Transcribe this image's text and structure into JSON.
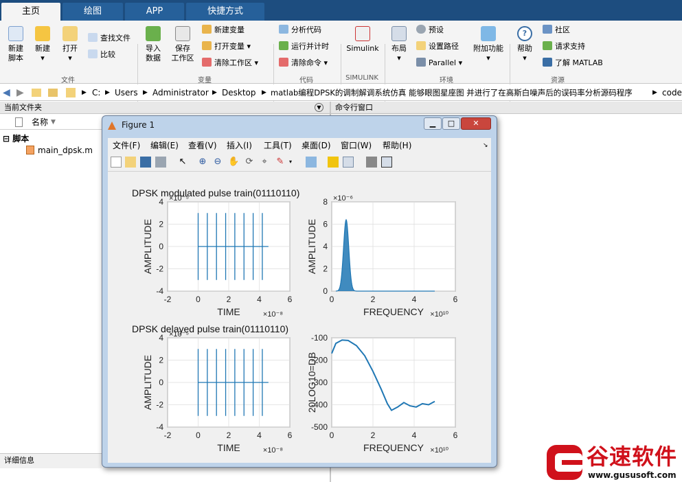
{
  "tabs": [
    "主页",
    "绘图",
    "APP",
    "快捷方式"
  ],
  "ribbon": {
    "file_group": {
      "label": "文件",
      "new_script": "新建\n脚本",
      "new": "新建",
      "open": "打开",
      "find_files": "查找文件",
      "compare": "比较"
    },
    "variable_group": {
      "label": "变量",
      "import": "导入\n数据",
      "save": "保存\n工作区",
      "new_var": "新建变量",
      "open_var": "打开变量",
      "clear_ws": "清除工作区"
    },
    "code_group": {
      "label": "代码",
      "analyze": "分析代码",
      "run_time": "运行并计时",
      "clear_cmd": "清除命令"
    },
    "simulink_group": {
      "label": "SIMULINK",
      "simulink": "Simulink"
    },
    "env_group": {
      "label": "环境",
      "layout": "布局",
      "prefs": "预设",
      "set_path": "设置路径",
      "parallel": "Parallel",
      "addons": "附加功能"
    },
    "resources_group": {
      "label": "资源",
      "help": "帮助",
      "community": "社区",
      "support": "请求支持",
      "learn": "了解 MATLAB"
    }
  },
  "address": {
    "path": [
      "C:",
      "Users",
      "Administrator",
      "Desktop",
      "matlab编程DPSK的调制解调系统仿真 能够眼图星座图 并进行了在高斯白噪声后的误码率分析源码程序",
      "code"
    ]
  },
  "left_panel": {
    "title": "当前文件夹",
    "column": "名称",
    "folder": "脚本",
    "file": "main_dpsk.m",
    "details": "详细信息"
  },
  "cmd_panel": {
    "title": "命令行窗口"
  },
  "figure": {
    "title": "Figure 1",
    "menus": [
      "文件(F)",
      "编辑(E)",
      "查看(V)",
      "插入(I)",
      "工具(T)",
      "桌面(D)",
      "窗口(W)",
      "帮助(H)"
    ]
  },
  "chart_data": [
    {
      "type": "line",
      "title": "DPSK modulated pulse train(01110110)",
      "xlabel": "TIME",
      "ylabel": "AMPLITUDE",
      "x_exponent": "×10⁻⁸",
      "y_exponent": "×10⁻⁵",
      "xlim": [
        -2,
        6
      ],
      "ylim": [
        -4,
        4
      ],
      "xticks": [
        "-2",
        "0",
        "2",
        "4",
        "6"
      ],
      "yticks": [
        "-4",
        "-2",
        "0",
        "2",
        "4"
      ],
      "pulse_times": [
        0.0,
        0.6,
        1.2,
        1.8,
        2.4,
        3.0,
        3.6,
        4.2
      ],
      "pulse_peak": 3,
      "pulse_trough": -3,
      "baseline_end": 4.6,
      "color": "#1f77b4"
    },
    {
      "type": "line",
      "title": "",
      "xlabel": "FREQUENCY",
      "ylabel": "AMPLITUDE",
      "x_exponent": "×10¹⁰",
      "y_exponent": "×10⁻⁶",
      "xlim": [
        0,
        6
      ],
      "ylim": [
        0,
        8
      ],
      "xticks": [
        "0",
        "2",
        "4",
        "6"
      ],
      "yticks": [
        "0",
        "2",
        "4",
        "6",
        "8"
      ],
      "peak_x": 0.7,
      "peak_y": 6.4,
      "end_x": 5,
      "color": "#1f77b4"
    },
    {
      "type": "line",
      "title": "DPSK delayed pulse train(01110110)",
      "xlabel": "TIME",
      "ylabel": "AMPLITUDE",
      "x_exponent": "×10⁻⁸",
      "y_exponent": "×10⁻⁵",
      "xlim": [
        -2,
        6
      ],
      "ylim": [
        -4,
        4
      ],
      "xticks": [
        "-2",
        "0",
        "2",
        "4",
        "6"
      ],
      "yticks": [
        "-4",
        "-2",
        "0",
        "2",
        "4"
      ],
      "pulse_times": [
        0.0,
        0.6,
        1.2,
        1.8,
        2.4,
        3.0,
        3.6,
        4.2
      ],
      "pulse_peak": 3,
      "pulse_trough": -3,
      "baseline_end": 4.6,
      "color": "#1f77b4"
    },
    {
      "type": "line",
      "title": "",
      "xlabel": "FREQUENCY",
      "ylabel": "20LOG10=DB",
      "x_exponent": "×10¹⁰",
      "y_exponent": "",
      "xlim": [
        0,
        6
      ],
      "ylim": [
        -500,
        -100
      ],
      "xticks": [
        "0",
        "2",
        "4",
        "6"
      ],
      "yticks": [
        "-500",
        "-400",
        "-300",
        "-200",
        "-100"
      ],
      "points": [
        [
          0,
          -170
        ],
        [
          0.2,
          -125
        ],
        [
          0.5,
          -110
        ],
        [
          0.8,
          -112
        ],
        [
          1.2,
          -135
        ],
        [
          1.6,
          -180
        ],
        [
          2.0,
          -250
        ],
        [
          2.4,
          -330
        ],
        [
          2.7,
          -395
        ],
        [
          2.9,
          -425
        ],
        [
          3.2,
          -410
        ],
        [
          3.5,
          -390
        ],
        [
          3.8,
          -405
        ],
        [
          4.1,
          -410
        ],
        [
          4.4,
          -395
        ],
        [
          4.7,
          -400
        ],
        [
          5.0,
          -385
        ]
      ],
      "color": "#1f77b4"
    }
  ],
  "watermark": {
    "brand": "谷速软件",
    "url": "www.gususoft.com",
    "color": "#d0111b"
  }
}
